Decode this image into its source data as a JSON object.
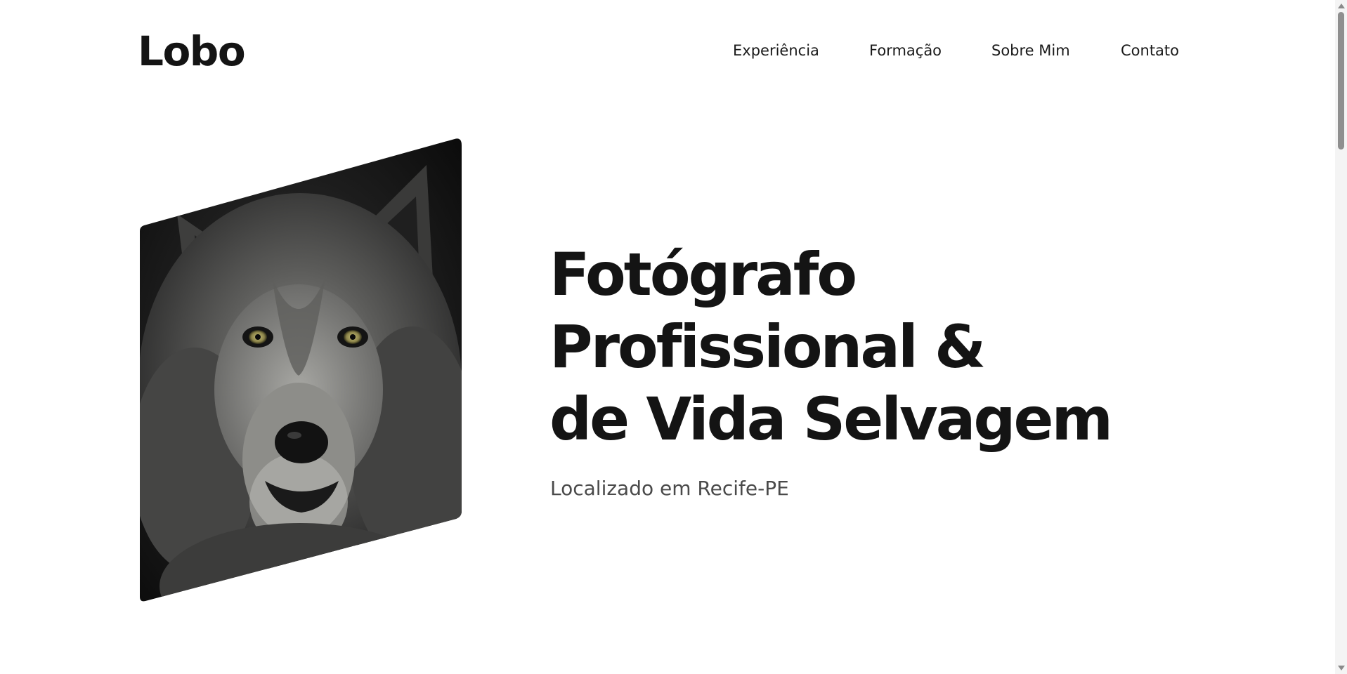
{
  "header": {
    "logo": "Lobo",
    "nav": [
      {
        "label": "Experiência"
      },
      {
        "label": "Formação"
      },
      {
        "label": "Sobre Mim"
      },
      {
        "label": "Contato"
      }
    ]
  },
  "hero": {
    "image_subject": "wolf-portrait",
    "title_lines": [
      "Fotógrafo",
      "Profissional &",
      "de Vida Selvagem"
    ],
    "subtitle": "Localizado em Recife-PE"
  },
  "colors": {
    "text": "#141414",
    "subtitle": "#4a4a4a",
    "background": "#ffffff"
  }
}
